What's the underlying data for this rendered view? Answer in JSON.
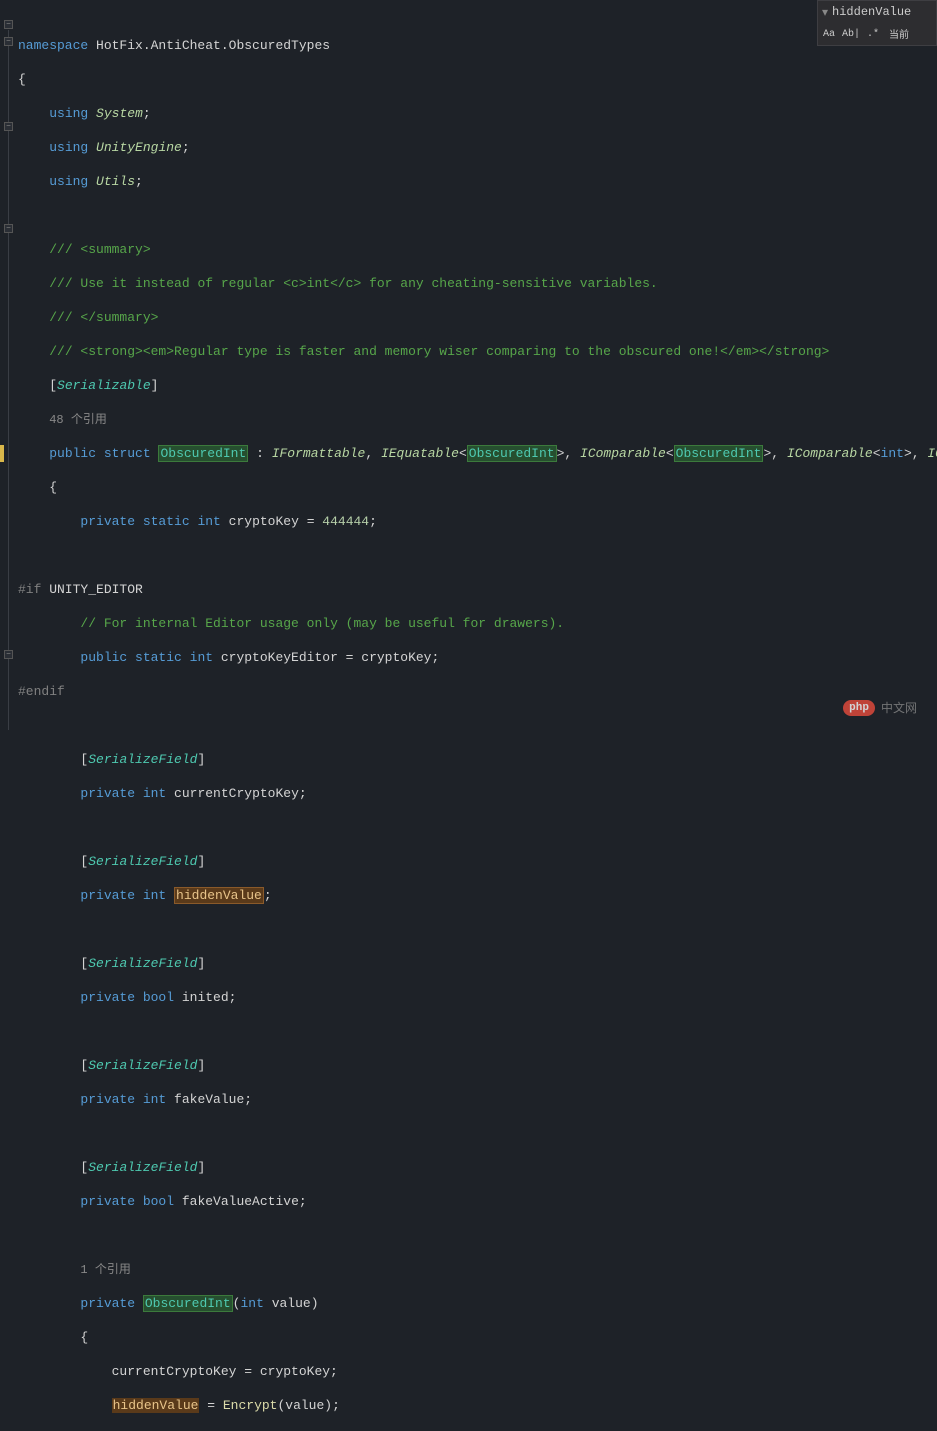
{
  "search": {
    "term": "hiddenValue",
    "buttons": {
      "case": "Aa",
      "word": "Ab|",
      "regex": ".*",
      "scope": "当前"
    },
    "arrow": "▾"
  },
  "gutter": {
    "collapse": "−"
  },
  "code": {
    "l1_kw": "namespace",
    "l1_ns": " HotFix.AntiCheat.ObscuredTypes",
    "l2": "{",
    "l3_kw": "using",
    "l3_ns": " System",
    "l3_semi": ";",
    "l4_kw": "using",
    "l4_ns": " UnityEngine",
    "l4_semi": ";",
    "l5_kw": "using",
    "l5_ns": " Utils",
    "l5_semi": ";",
    "l7": "/// <summary>",
    "l8": "/// Use it instead of regular <c>int</c> for any cheating-sensitive variables.",
    "l9": "/// </summary>",
    "l10": "/// <strong><em>Regular type is faster and memory wiser comparing to the obscured one!</em></strong>",
    "l11_open": "[",
    "l11_attr": "Serializable",
    "l11_close": "]",
    "l12": "48 个引用",
    "l13_kw1": "public",
    "l13_kw2": "struct",
    "l13_type": "ObscuredInt",
    "l13_colon": " : ",
    "l13_i1": "IFormattable",
    "l13_c1": ", ",
    "l13_i2": "IEquatable",
    "l13_lt": "<",
    "l13_g1": "ObscuredInt",
    "l13_gt": ">",
    "l13_c2": ", ",
    "l13_i3": "IComparable",
    "l13_g2": "ObscuredInt",
    "l13_c3": ", ",
    "l13_i4": "IComparable",
    "l13_int": "int",
    "l13_c4": ", ",
    "l13_i5": "IComparable",
    "l14": "{",
    "l15_kw": "private static int",
    "l15_f": " cryptoKey ",
    "l15_eq": "= ",
    "l15_num": "444444",
    "l15_semi": ";",
    "l17_pre": "#if",
    "l17_sym": " UNITY_EDITOR",
    "l18": "// For internal Editor usage only (may be useful for drawers).",
    "l19_kw": "public static int",
    "l19_f": " cryptoKeyEditor ",
    "l19_eq": "= cryptoKey;",
    "l20": "#endif",
    "l22_open": "[",
    "l22_attr": "SerializeField",
    "l22_close": "]",
    "l23_kw": "private int",
    "l23_f": " currentCryptoKey;",
    "l25_open": "[",
    "l25_attr": "SerializeField",
    "l25_close": "]",
    "l26_kw": "private int ",
    "l26_f": "hiddenValue",
    "l26_semi": ";",
    "l28_open": "[",
    "l28_attr": "SerializeField",
    "l28_close": "]",
    "l29_kw": "private bool",
    "l29_f": " inited;",
    "l31_open": "[",
    "l31_attr": "SerializeField",
    "l31_close": "]",
    "l32_kw": "private int",
    "l32_f": " fakeValue;",
    "l34_open": "[",
    "l34_attr": "SerializeField",
    "l34_close": "]",
    "l35_kw": "private bool",
    "l35_f": " fakeValueActive;",
    "l37": "1 个引用",
    "l38_kw": "private ",
    "l38_type": "ObscuredInt",
    "l38_p1": "(",
    "l38_pkw": "int",
    "l38_pn": " value",
    "l38_p2": ")",
    "l39": "{",
    "l40_a": "currentCryptoKey = cryptoKey;",
    "l41_a": "hiddenValue",
    "l41_b": " = ",
    "l41_m": "Encrypt",
    "l41_c": "(value);"
  },
  "watermark": {
    "logo": "php",
    "text": "中文网"
  }
}
